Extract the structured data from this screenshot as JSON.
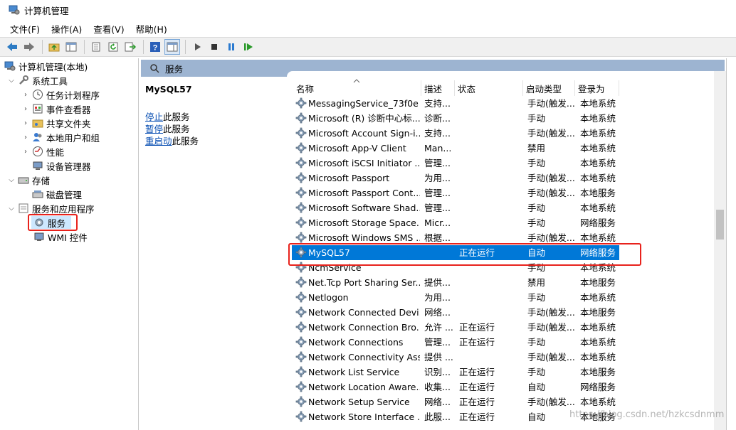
{
  "window": {
    "title": "计算机管理"
  },
  "menu": [
    "文件(F)",
    "操作(A)",
    "查看(V)",
    "帮助(H)"
  ],
  "toolbar": {
    "icons": [
      "back-arrow-icon",
      "forward-arrow-icon",
      "up-folder-icon",
      "show-tree-icon",
      "properties-icon",
      "refresh-icon",
      "export-icon",
      "help-icon",
      "console-icon",
      "play-icon",
      "stop-icon",
      "pause-icon",
      "restart-icon"
    ]
  },
  "tree": {
    "root": "计算机管理(本地)",
    "system_tools": "系统工具",
    "task_scheduler": "任务计划程序",
    "event_viewer": "事件查看器",
    "shared_folders": "共享文件夹",
    "local_users": "本地用户和组",
    "performance": "性能",
    "device_manager": "设备管理器",
    "storage": "存储",
    "disk_management": "磁盘管理",
    "services_apps": "服务和应用程序",
    "services": "服务",
    "wmi": "WMI 控件"
  },
  "header": {
    "title": "服务"
  },
  "info": {
    "service_name": "MySQL57",
    "stop_link": "停止",
    "stop_suffix": "此服务",
    "pause_link": "暂停",
    "pause_suffix": "此服务",
    "restart_link": "重启动",
    "restart_suffix": "此服务"
  },
  "columns": {
    "name": "名称",
    "desc": "描述",
    "status": "状态",
    "startup": "启动类型",
    "logon": "登录为"
  },
  "rows": [
    {
      "name": "MessagingService_73f0e",
      "desc": "支持...",
      "status": "",
      "startup": "手动(触发...",
      "logon": "本地系统"
    },
    {
      "name": "Microsoft (R) 诊断中心标...",
      "desc": "诊断...",
      "status": "",
      "startup": "手动",
      "logon": "本地系统"
    },
    {
      "name": "Microsoft Account Sign-i...",
      "desc": "支持...",
      "status": "",
      "startup": "手动(触发...",
      "logon": "本地系统"
    },
    {
      "name": "Microsoft App-V Client",
      "desc": "Man...",
      "status": "",
      "startup": "禁用",
      "logon": "本地系统"
    },
    {
      "name": "Microsoft iSCSI Initiator ...",
      "desc": "管理...",
      "status": "",
      "startup": "手动",
      "logon": "本地系统"
    },
    {
      "name": "Microsoft Passport",
      "desc": "为用...",
      "status": "",
      "startup": "手动(触发...",
      "logon": "本地系统"
    },
    {
      "name": "Microsoft Passport Cont...",
      "desc": "管理...",
      "status": "",
      "startup": "手动(触发...",
      "logon": "本地服务"
    },
    {
      "name": "Microsoft Software Shad...",
      "desc": "管理...",
      "status": "",
      "startup": "手动",
      "logon": "本地系统"
    },
    {
      "name": "Microsoft Storage Space...",
      "desc": "Micr...",
      "status": "",
      "startup": "手动",
      "logon": "网络服务"
    },
    {
      "name": "Microsoft Windows SMS ...",
      "desc": "根据...",
      "status": "",
      "startup": "手动(触发...",
      "logon": "本地系统"
    },
    {
      "name": "MySQL57",
      "desc": "",
      "status": "正在运行",
      "startup": "自动",
      "logon": "网络服务"
    },
    {
      "name": "NcmService",
      "desc": "",
      "status": "",
      "startup": "手动",
      "logon": "本地系统"
    },
    {
      "name": "Net.Tcp Port Sharing Ser...",
      "desc": "提供...",
      "status": "",
      "startup": "禁用",
      "logon": "本地服务"
    },
    {
      "name": "Netlogon",
      "desc": "为用...",
      "status": "",
      "startup": "手动",
      "logon": "本地系统"
    },
    {
      "name": "Network Connected Devi...",
      "desc": "网络...",
      "status": "",
      "startup": "手动(触发...",
      "logon": "本地服务"
    },
    {
      "name": "Network Connection Bro...",
      "desc": "允许 ...",
      "status": "正在运行",
      "startup": "手动(触发...",
      "logon": "本地系统"
    },
    {
      "name": "Network Connections",
      "desc": "管理...",
      "status": "正在运行",
      "startup": "手动",
      "logon": "本地系统"
    },
    {
      "name": "Network Connectivity Ass...",
      "desc": "提供 ...",
      "status": "",
      "startup": "手动(触发...",
      "logon": "本地系统"
    },
    {
      "name": "Network List Service",
      "desc": "识别...",
      "status": "正在运行",
      "startup": "手动",
      "logon": "本地服务"
    },
    {
      "name": "Network Location Aware...",
      "desc": "收集...",
      "status": "正在运行",
      "startup": "自动",
      "logon": "网络服务"
    },
    {
      "name": "Network Setup Service",
      "desc": "网络...",
      "status": "正在运行",
      "startup": "手动(触发...",
      "logon": "本地系统"
    },
    {
      "name": "Network Store Interface ...",
      "desc": "此服...",
      "status": "正在运行",
      "startup": "自动",
      "logon": "本地服务"
    }
  ],
  "watermark": "https://blog.csdn.net/hzkcsdnmm"
}
